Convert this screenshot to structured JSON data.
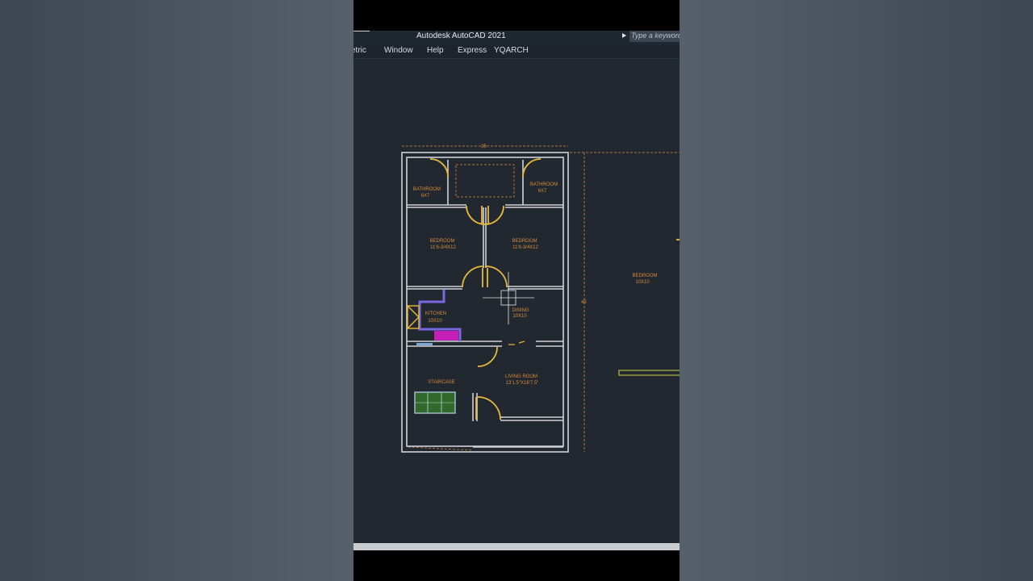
{
  "window": {
    "title": "Autodesk AutoCAD 2021",
    "search_placeholder": "Type a keyword"
  },
  "menu": {
    "items": [
      "etric",
      "Window",
      "Help",
      "Express",
      "YQARCH"
    ]
  },
  "plan": {
    "dims": {
      "width": "25",
      "depth": "45"
    },
    "rooms": [
      {
        "name": "BATHROOM",
        "size": "6X7"
      },
      {
        "name": "BATHROOM",
        "size": "6X7"
      },
      {
        "name": "BEDROOM",
        "size": "11'6-3/4X12"
      },
      {
        "name": "BEDROOM",
        "size": "11'6-3/4X12"
      },
      {
        "name": "KITCHEN",
        "size": "10X10"
      },
      {
        "name": "DINING",
        "size": "10X10"
      },
      {
        "name": "STAIRCASE",
        "size": ""
      },
      {
        "name": "LIVING ROOM",
        "size": "13'1.5\"X16'7.5\""
      },
      {
        "name": "BEDROOM",
        "size": "10X10"
      }
    ]
  },
  "colors": {
    "wall": "#cfd3d8",
    "door": "#e9b93a",
    "text": "#d98a3a",
    "kitchen_counter": "#7b67e0",
    "sink": "#c51fb8",
    "stair": "#2f6a2a"
  },
  "icons": {
    "arrow": "caret-right-icon",
    "crosshair": "crosshair-cursor-icon"
  }
}
